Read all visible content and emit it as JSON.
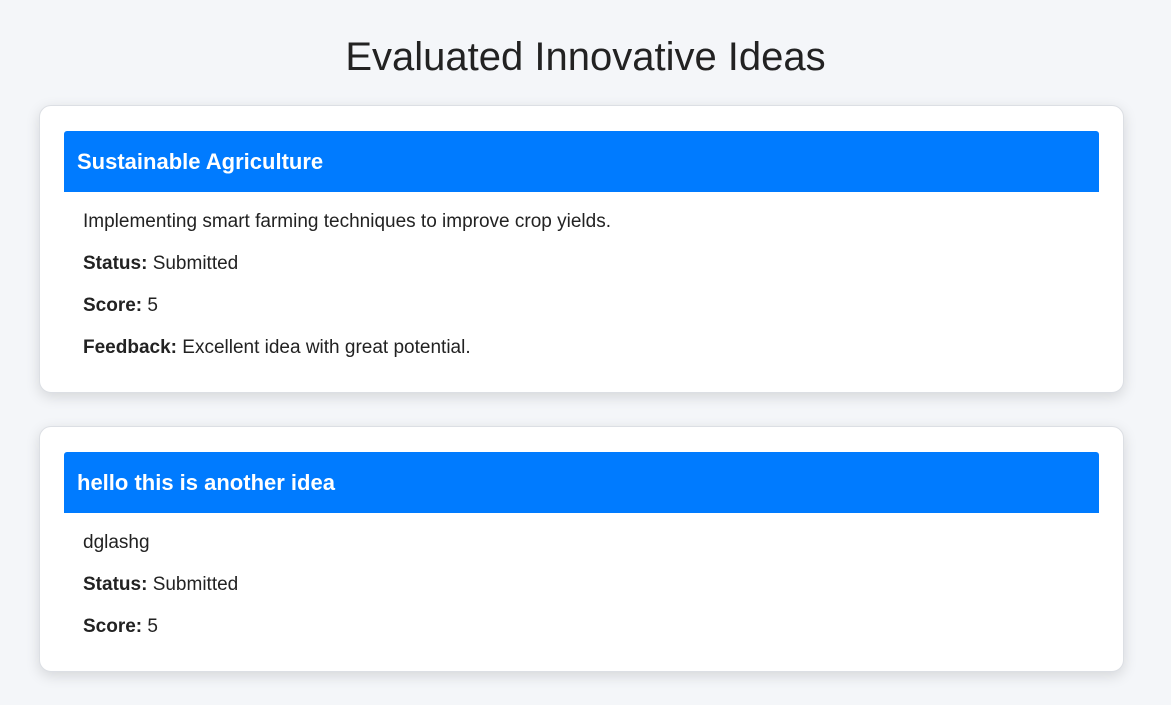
{
  "page": {
    "title": "Evaluated Innovative Ideas"
  },
  "labels": {
    "status": "Status:",
    "score": "Score:",
    "feedback": "Feedback:"
  },
  "ideas": [
    {
      "title": "Sustainable Agriculture",
      "description": "Implementing smart farming techniques to improve crop yields.",
      "status": "Submitted",
      "score": "5",
      "feedback": "Excellent idea with great potential."
    },
    {
      "title": "hello this is another idea",
      "description": "dglashg",
      "status": "Submitted",
      "score": "5"
    }
  ],
  "colors": {
    "accent": "#007bff",
    "background": "#f4f6f9",
    "card": "#ffffff"
  }
}
